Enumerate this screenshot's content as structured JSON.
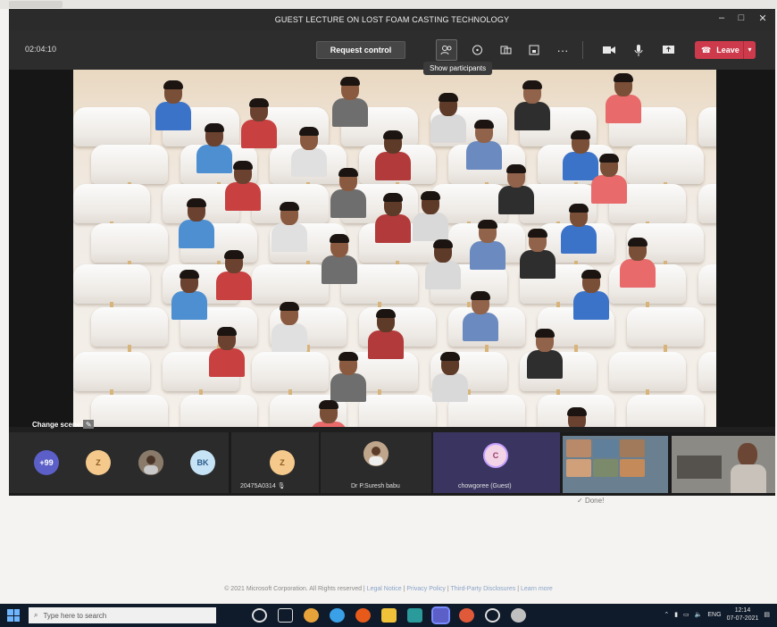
{
  "window": {
    "title": "GUEST LECTURE ON LOST FOAM CASTING TECHNOLOGY",
    "minimize_icon": "minimize-icon",
    "maximize_icon": "maximize-icon",
    "close_icon": "close-icon"
  },
  "callbar": {
    "timer": "02:04:10",
    "request_control_label": "Request control",
    "controls": [
      "participants-icon",
      "chat-icon",
      "reactions-icon",
      "rooms-icon",
      "more-icon",
      "camera-icon",
      "mic-icon",
      "share-icon"
    ],
    "leave_label": "Leave"
  },
  "tooltip": "Show participants",
  "stage": {
    "change_scene_label": "Change scene",
    "accent_seat_leg": "#d8b47a"
  },
  "tiles": {
    "overflow_count": "+99",
    "participants": [
      {
        "initials": "",
        "name": "",
        "color": "#f4c98b"
      },
      {
        "initials": "",
        "name": "",
        "color": "#777777"
      },
      {
        "initials": "BK",
        "name": "",
        "color": "#c6e3f5"
      },
      {
        "initials": "",
        "name": "20475A0314",
        "color": "#f4c98b"
      },
      {
        "initials": "",
        "name": "Dr P.Suresh babu",
        "color": "#8b6b54"
      },
      {
        "initials": "C",
        "name": "chowgoree (Guest)",
        "color": "#f2d4e6"
      }
    ]
  },
  "done_label": "Done!",
  "footer": {
    "copyright": "© 2021 Microsoft Corporation. All Rights reserved",
    "links": [
      "Legal Notice",
      "Privacy Policy",
      "Third-Party Disclosures",
      "Learn more"
    ]
  },
  "taskbar": {
    "search_placeholder": "Type here to search",
    "language": "ENG",
    "time": "12:14",
    "date": "07-07-2021"
  },
  "colors": {
    "leave": "#cc3a4b",
    "callbar": "#2d2d2d",
    "taskbar": "#0f1a2a"
  }
}
